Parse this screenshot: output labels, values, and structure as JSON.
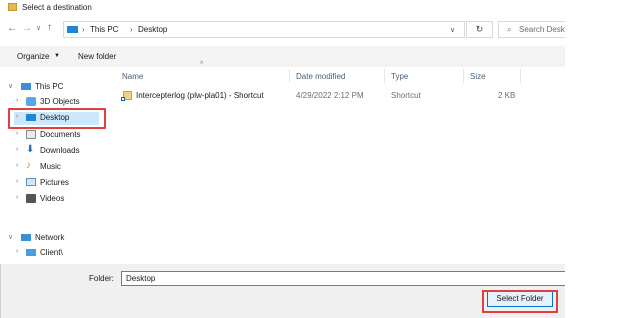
{
  "window": {
    "title": "Select a destination"
  },
  "address": {
    "segments": [
      "This PC",
      "Desktop"
    ]
  },
  "search": {
    "placeholder": "Search Deskt"
  },
  "toolbar": {
    "organize_label": "Organize",
    "new_folder_label": "New folder"
  },
  "nav": {
    "items": [
      {
        "label": "This PC",
        "icon": "pc-icon"
      },
      {
        "label": "3D Objects",
        "icon": "3d-objects-icon"
      },
      {
        "label": "Desktop",
        "icon": "desktop-folder-icon",
        "selected": true
      },
      {
        "label": "Documents",
        "icon": "documents-icon"
      },
      {
        "label": "Downloads",
        "icon": "downloads-icon"
      },
      {
        "label": "Music",
        "icon": "music-icon"
      },
      {
        "label": "Pictures",
        "icon": "pictures-icon"
      },
      {
        "label": "Videos",
        "icon": "videos-icon"
      },
      {
        "label": "Network",
        "icon": "network-icon"
      },
      {
        "label": "Client\\",
        "icon": "client-drive-icon"
      }
    ]
  },
  "columns": [
    "Name",
    "Date modified",
    "Type",
    "Size"
  ],
  "files": [
    {
      "name": "Intercepterlog (plw-pla01) - Shortcut",
      "date": "4/29/2022 2:12 PM",
      "type": "Shortcut",
      "size": "2 KB",
      "icon": "shortcut-icon"
    }
  ],
  "footer": {
    "folder_label": "Folder:",
    "folder_value": "Desktop",
    "select_button": "Select Folder"
  },
  "colors": {
    "highlight": "#e0403f",
    "selection": "#cce8ff",
    "accent": "#0078d7"
  }
}
